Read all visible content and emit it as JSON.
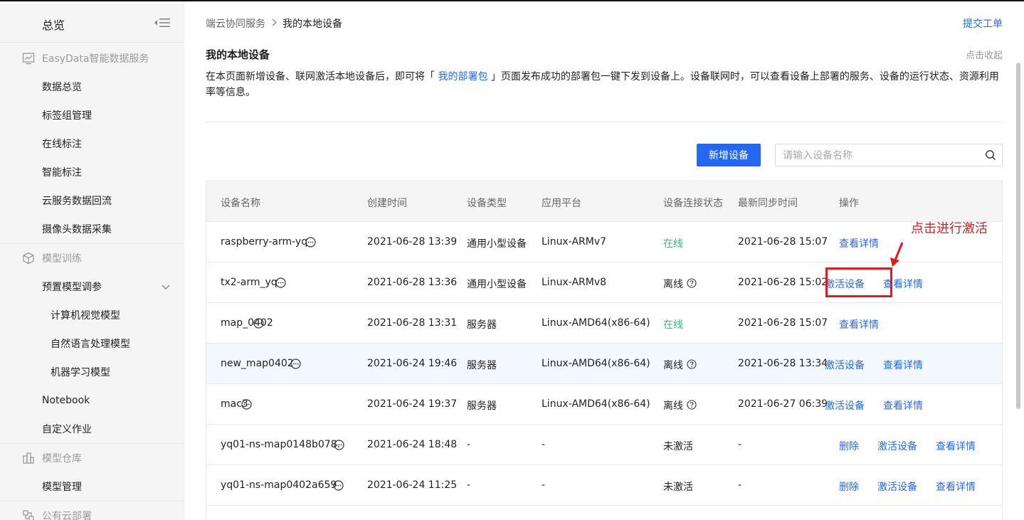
{
  "sidebar": {
    "title": "总览",
    "groups": [
      {
        "label": "EasyData智能数据服务",
        "icon": "chart-icon"
      },
      {
        "label": "模型训练",
        "icon": "cube-icon"
      },
      {
        "label": "模型仓库",
        "icon": "warehouse-icon"
      },
      {
        "label": "公有云部署",
        "icon": "cloud-deploy-icon"
      }
    ],
    "items": [
      {
        "label": "数据总览"
      },
      {
        "label": "标签组管理"
      },
      {
        "label": "在线标注"
      },
      {
        "label": "智能标注"
      },
      {
        "label": "云服务数据回流"
      },
      {
        "label": "摄像头数据采集"
      },
      {
        "label": "预置模型调参"
      },
      {
        "label": "计算机视觉模型"
      },
      {
        "label": "自然语言处理模型"
      },
      {
        "label": "机器学习模型"
      },
      {
        "label": "Notebook"
      },
      {
        "label": "自定义作业"
      },
      {
        "label": "模型管理"
      }
    ]
  },
  "header": {
    "breadcrumb": [
      "端云协同服务",
      "我的本地设备"
    ],
    "submit_ticket": "提交工单"
  },
  "main": {
    "title": "我的本地设备",
    "collapse": "点击收起",
    "desc_before": "在本页面新增设备、联网激活本地设备后，即可将「 ",
    "desc_link": "我的部署包",
    "desc_after": " 」页面发布成功的部署包一键下发到设备上。设备联网时，可以查看设备上部署的服务、设备的运行状态、资源利用率等信息。",
    "add_button": "新增设备",
    "search_placeholder": "请输入设备名称"
  },
  "table": {
    "columns": [
      "设备名称",
      "创建时间",
      "设备类型",
      "应用平台",
      "设备连接状态",
      "最新同步时间",
      "操作"
    ],
    "rows": [
      {
        "name": "raspberry-arm-yq",
        "created": "2021-06-28 13:39",
        "type": "通用小型设备",
        "platform": "Linux-ARMv7",
        "status": "在线",
        "synced": "2021-06-28 15:07",
        "actions": [
          "查看详情"
        ]
      },
      {
        "name": "tx2-arm_yq",
        "created": "2021-06-28 13:36",
        "type": "通用小型设备",
        "platform": "Linux-ARMv8",
        "status": "离线",
        "synced": "2021-06-28 15:02",
        "actions": [
          "激活设备",
          "查看详情"
        ]
      },
      {
        "name": "map_0402",
        "created": "2021-06-28 13:31",
        "type": "服务器",
        "platform": "Linux-AMD64(x86-64)",
        "status": "在线",
        "synced": "2021-06-28 15:07",
        "actions": [
          "查看详情"
        ]
      },
      {
        "name": "new_map0402",
        "created": "2021-06-24 19:46",
        "type": "服务器",
        "platform": "Linux-AMD64(x86-64)",
        "status": "离线",
        "synced": "2021-06-28 13:34",
        "actions": [
          "激活设备",
          "查看详情"
        ]
      },
      {
        "name": "mac3",
        "created": "2021-06-24 19:37",
        "type": "服务器",
        "platform": "Linux-AMD64(x86-64)",
        "status": "离线",
        "synced": "2021-06-27 06:39",
        "actions": [
          "激活设备",
          "查看详情"
        ]
      },
      {
        "name": "yq01-ns-map0148b078.",
        "created": "2021-06-24 18:48",
        "type": "-",
        "platform": "-",
        "status": "未激活",
        "synced": "-",
        "actions": [
          "删除",
          "激活设备",
          "查看详情"
        ]
      },
      {
        "name": "yq01-ns-map0402a659",
        "created": "2021-06-24 11:25",
        "type": "-",
        "platform": "-",
        "status": "未激活",
        "synced": "-",
        "actions": [
          "删除",
          "激活设备",
          "查看详情"
        ]
      }
    ]
  },
  "annotation": {
    "text": "点击进行激活"
  },
  "colors": {
    "accent": "#2468f2",
    "online": "#30bf7a",
    "annotation": "#e5191f"
  }
}
